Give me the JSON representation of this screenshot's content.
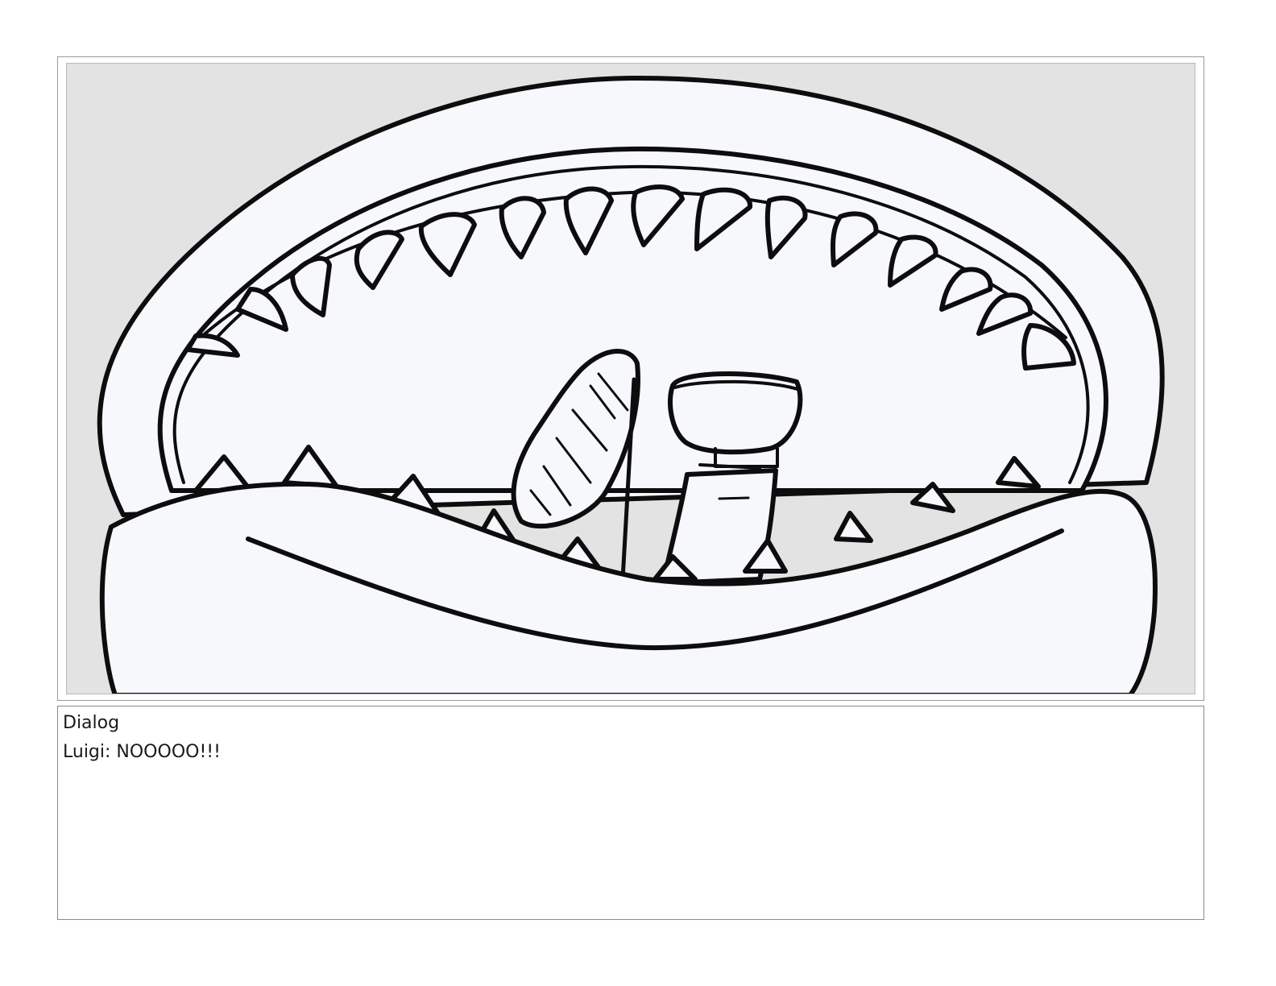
{
  "panel": {
    "illustration_icon": "monster-mouth-icon",
    "colors": {
      "background": "#e3e3e3",
      "fill": "#f6f8fc",
      "ink": "#0d0d0d"
    }
  },
  "dialog": {
    "heading": "Dialog",
    "line": "Luigi: NOOOOO!!!"
  }
}
